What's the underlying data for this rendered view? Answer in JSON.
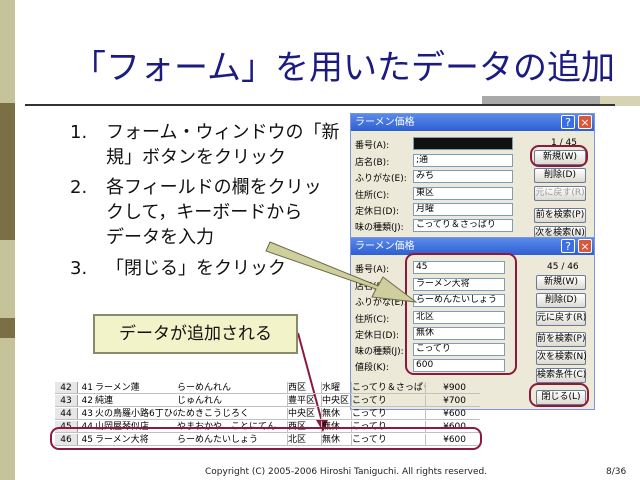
{
  "slide": {
    "title": "「フォーム」を用いたデータの追加",
    "steps": [
      {
        "num": "1.",
        "lines": [
          "フォーム・ウィンドウの「新",
          "規」ボタンをクリック"
        ]
      },
      {
        "num": "2.",
        "lines": [
          "各フィールドの欄をクリッ",
          "クして，キーボードから",
          "データを入力"
        ]
      },
      {
        "num": "3.",
        "lines": [
          "「閉じる」をクリック"
        ]
      }
    ],
    "callout": "データが追加される",
    "footer": "Copyright (C) 2005-2006 Hiroshi Taniguchi. All rights reserved.",
    "page": "8/36"
  },
  "form_back": {
    "title": "ラーメン価格",
    "help": "?",
    "close": "×",
    "record": "1 / 45",
    "labels": [
      "番号(A):",
      "店名(B):",
      "ふりがな(E):",
      "住所(C):",
      "定休日(D):",
      "味の種類(J):"
    ],
    "values": [
      "",
      ";通",
      "みち",
      "東区",
      "月曜",
      "こってり＆さっぱり"
    ],
    "buttons": [
      "新規(W)",
      "削除(D)",
      "元に戻す(R)",
      "前を検索(P)",
      "次を検索(N)"
    ]
  },
  "form_front": {
    "title": "ラーメン価格",
    "help": "?",
    "close": "×",
    "record": "45 / 46",
    "labels": [
      "番号(A):",
      "店名(B):",
      "ふりがな(E):",
      "住所(C):",
      "定休日(D):",
      "味の種類(J):",
      "値段(K):"
    ],
    "values": [
      "45",
      "ラーメン大将",
      "らーめんたいしょう",
      "北区",
      "無休",
      "こってり",
      "600"
    ],
    "buttons": [
      "新規(W)",
      "削除(D)",
      "元に戻す(R)",
      "前を検索(P)",
      "次を検索(N)",
      "検索条件(C)",
      "閉じる(L)"
    ]
  },
  "sheet": {
    "rows": [
      {
        "idx": "42",
        "no": "41",
        "name": "ラーメン蓮",
        "kana": "らーめんれん",
        "addr": "西区",
        "off": "水曜",
        "taste": "こってり＆さっぱり",
        "price": "¥900"
      },
      {
        "idx": "43",
        "no": "42",
        "name": "純連",
        "kana": "じゅんれん",
        "addr": "豊平区",
        "off": "中央区",
        "taste": "こってり",
        "price": "¥700"
      },
      {
        "idx": "44",
        "no": "43",
        "name": "火の鳥羅小路6丁ひのとり",
        "kana": "ためきこうじろく",
        "addr": "中央区",
        "off": "無休",
        "taste": "こってり",
        "price": "¥600"
      },
      {
        "idx": "45",
        "no": "44",
        "name": "山岡屋琴似店",
        "kana": "やまおかや　ことにてん",
        "addr": "西区",
        "off": "無休",
        "taste": "こってり",
        "price": "¥600"
      },
      {
        "idx": "46",
        "no": "45",
        "name": "ラーメン大将",
        "kana": "らーめんたいしょう",
        "addr": "北区",
        "off": "無休",
        "taste": "こってり",
        "price": "¥600"
      }
    ]
  }
}
